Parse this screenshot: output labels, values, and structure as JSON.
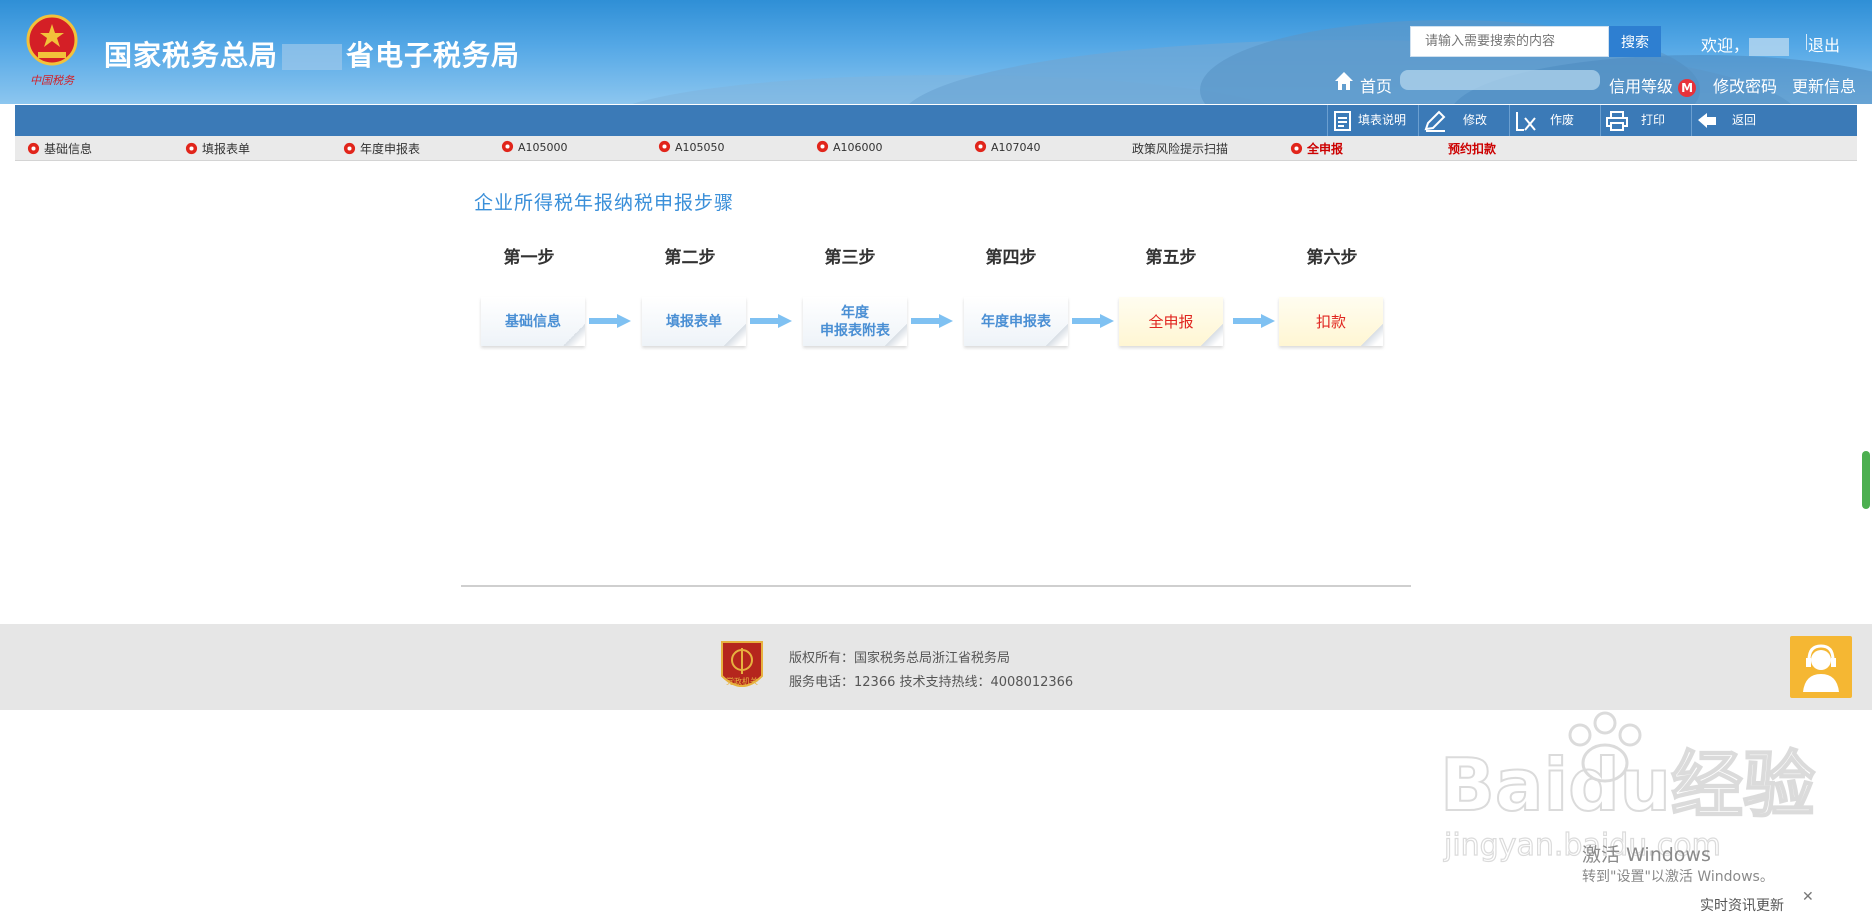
{
  "header": {
    "title_prefix": "国家税务总局",
    "title_suffix": "省电子税务局",
    "emblem_text": "中国税务",
    "search_placeholder": "请输入需要搜索的内容",
    "search_button": "搜索",
    "welcome": "欢迎，",
    "logout": "退出",
    "home": "首页",
    "credit_level": "信用等级",
    "credit_badge": "M",
    "change_password": "修改密码",
    "update_info": "更新信息"
  },
  "toolbar": {
    "buttons": [
      {
        "label": "填表说明",
        "icon": "document-icon"
      },
      {
        "label": "修改",
        "icon": "pencil-icon"
      },
      {
        "label": "作废",
        "icon": "void-icon"
      },
      {
        "label": "打印",
        "icon": "printer-icon"
      },
      {
        "label": "返回",
        "icon": "return-icon"
      }
    ]
  },
  "tabs": [
    {
      "label": "基础信息"
    },
    {
      "label": "填报表单"
    },
    {
      "label": "年度申报表"
    },
    {
      "label": "A105000"
    },
    {
      "label": "A105050"
    },
    {
      "label": "A106000"
    },
    {
      "label": "A107040"
    },
    {
      "label": "政策风险提示扫描"
    },
    {
      "label": "全申报"
    },
    {
      "label": "预约扣款"
    }
  ],
  "main": {
    "title": "企业所得税年报纳税申报步骤",
    "steps": [
      {
        "heading": "第一步",
        "label": "基础信息"
      },
      {
        "heading": "第二步",
        "label": "填报表单"
      },
      {
        "heading": "第三步",
        "label_line1": "年度",
        "label_line2": "申报表附表"
      },
      {
        "heading": "第四步",
        "label": "年度申报表"
      },
      {
        "heading": "第五步",
        "label": "全申报"
      },
      {
        "heading": "第六步",
        "label": "扣款"
      }
    ]
  },
  "footer": {
    "copyright": "版权所有：国家税务总局浙江省税务局",
    "service": "服务电话：12366 技术支持热线：4008012366",
    "emblem_text": "党政机关"
  },
  "overlay": {
    "watermark": "Baidu经验",
    "watermark_url": "jingyan.baidu.com",
    "activate_title": "激活 Windows",
    "activate_hint": "转到\"设置\"以激活 Windows。",
    "news": "实时资讯更新",
    "close": "✕"
  },
  "colors": {
    "toolbar_blue": "#3b7ab7",
    "title_blue": "#3a8fd9",
    "alert_red": "#e0251f",
    "tab_red": "#cc0000"
  }
}
